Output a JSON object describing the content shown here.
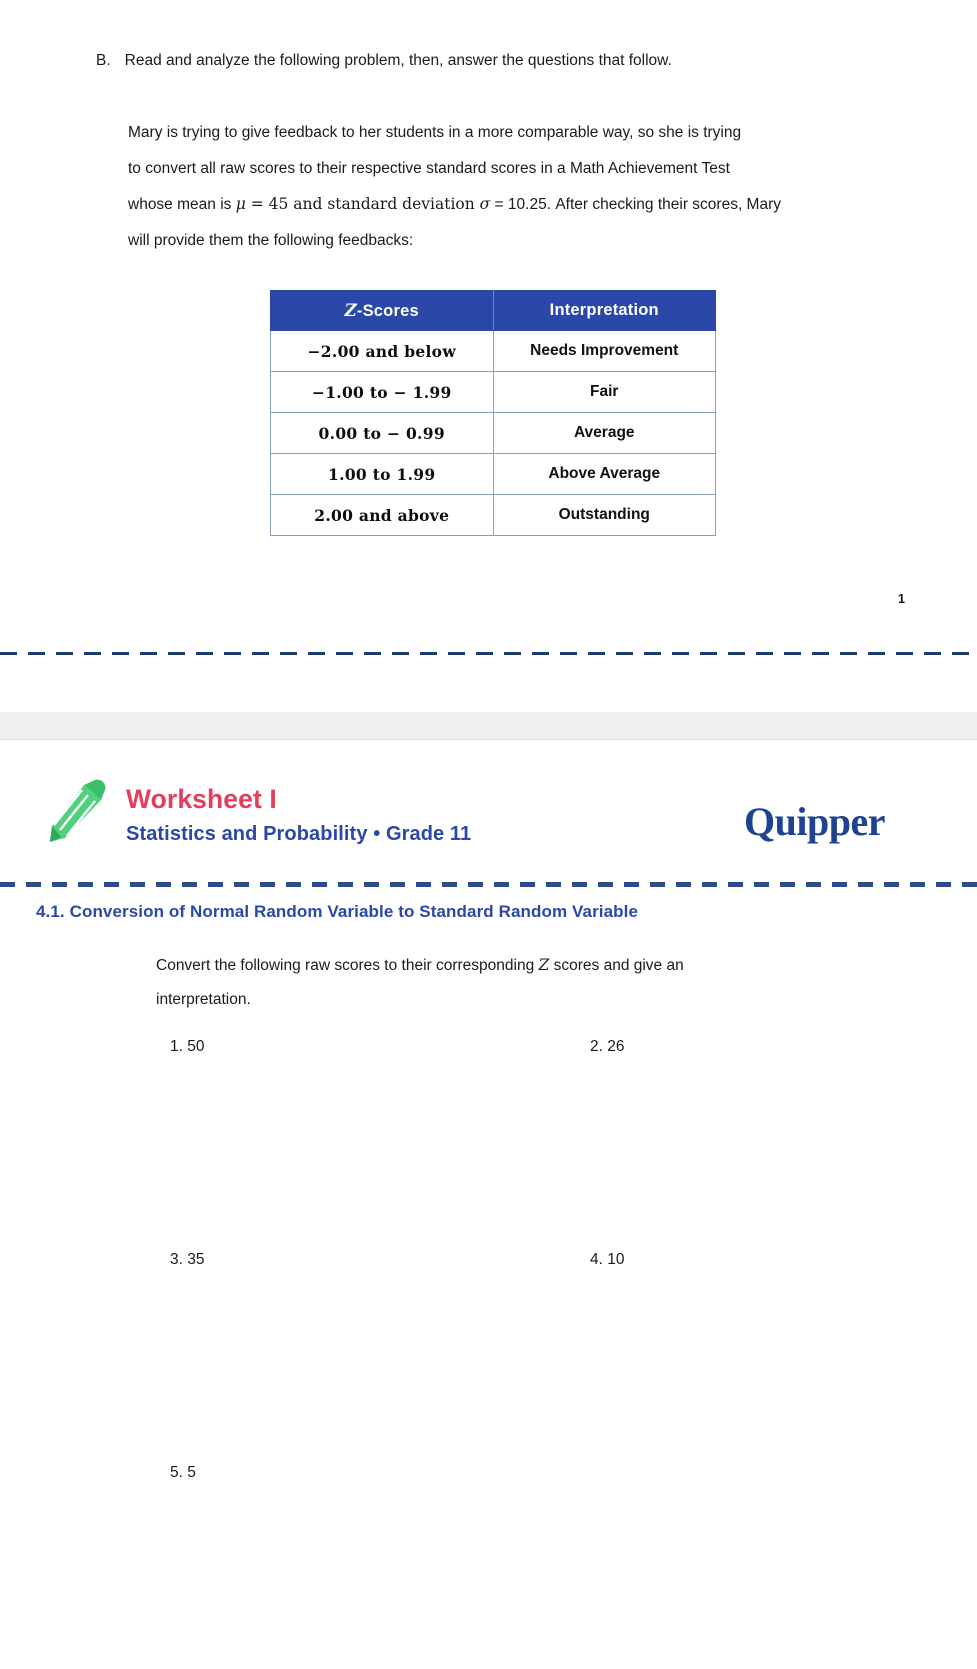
{
  "page_one": {
    "section_letter": "B.",
    "section_instruction": "Read and analyze the following problem, then, answer the questions that follow.",
    "problem": {
      "line1": "Mary is trying to give feedback to her students in a more comparable way, so she is trying",
      "line2": "to convert all raw scores to their respective standard scores in a Math Achievement Test",
      "line3_a": "whose mean is ",
      "line3_mu": "μ",
      "line3_b": " = 45 and standard deviation ",
      "line3_sigma": "σ",
      "line3_c": " = 10.25. After checking their scores, Mary",
      "line4": "will provide them the following feedbacks:"
    },
    "table": {
      "headers": {
        "z": "Z",
        "z_suffix": "-Scores",
        "interpretation": "Interpretation"
      },
      "rows": [
        {
          "z": "−2.00 and below",
          "interpretation": "Needs Improvement"
        },
        {
          "z": "−1.00 to − 1.99",
          "interpretation": "Fair"
        },
        {
          "z": "0.00 to − 0.99",
          "interpretation": "Average"
        },
        {
          "z": "1.00 to 1.99",
          "interpretation": "Above Average"
        },
        {
          "z": "2.00 and above",
          "interpretation": "Outstanding"
        }
      ]
    },
    "page_number": "1"
  },
  "page_two": {
    "worksheet_title": "Worksheet I",
    "worksheet_subtitle": "Statistics and Probability • Grade 11",
    "brand": "Quipper",
    "section_heading": "4.1. Conversion of Normal Random Variable to Standard Random Variable",
    "instructions": {
      "part_a": "Convert the following raw scores to their corresponding ",
      "z": "Z",
      "part_b": " scores and give an",
      "line2": "interpretation."
    },
    "questions": [
      {
        "number": "1.",
        "value": "50"
      },
      {
        "number": "2.",
        "value": "26"
      },
      {
        "number": "3.",
        "value": "35"
      },
      {
        "number": "4.",
        "value": "10"
      },
      {
        "number": "5.",
        "value": "5"
      }
    ]
  },
  "colors": {
    "table_header_bg": "#2b47a8",
    "table_border": "#8ba0bd",
    "worksheet_title": "#e0405e",
    "worksheet_subtitle": "#2b47a8",
    "brand": "#1e4491",
    "pencil_green": "#3cc06a",
    "dashed_line": "#2d4a8a"
  }
}
